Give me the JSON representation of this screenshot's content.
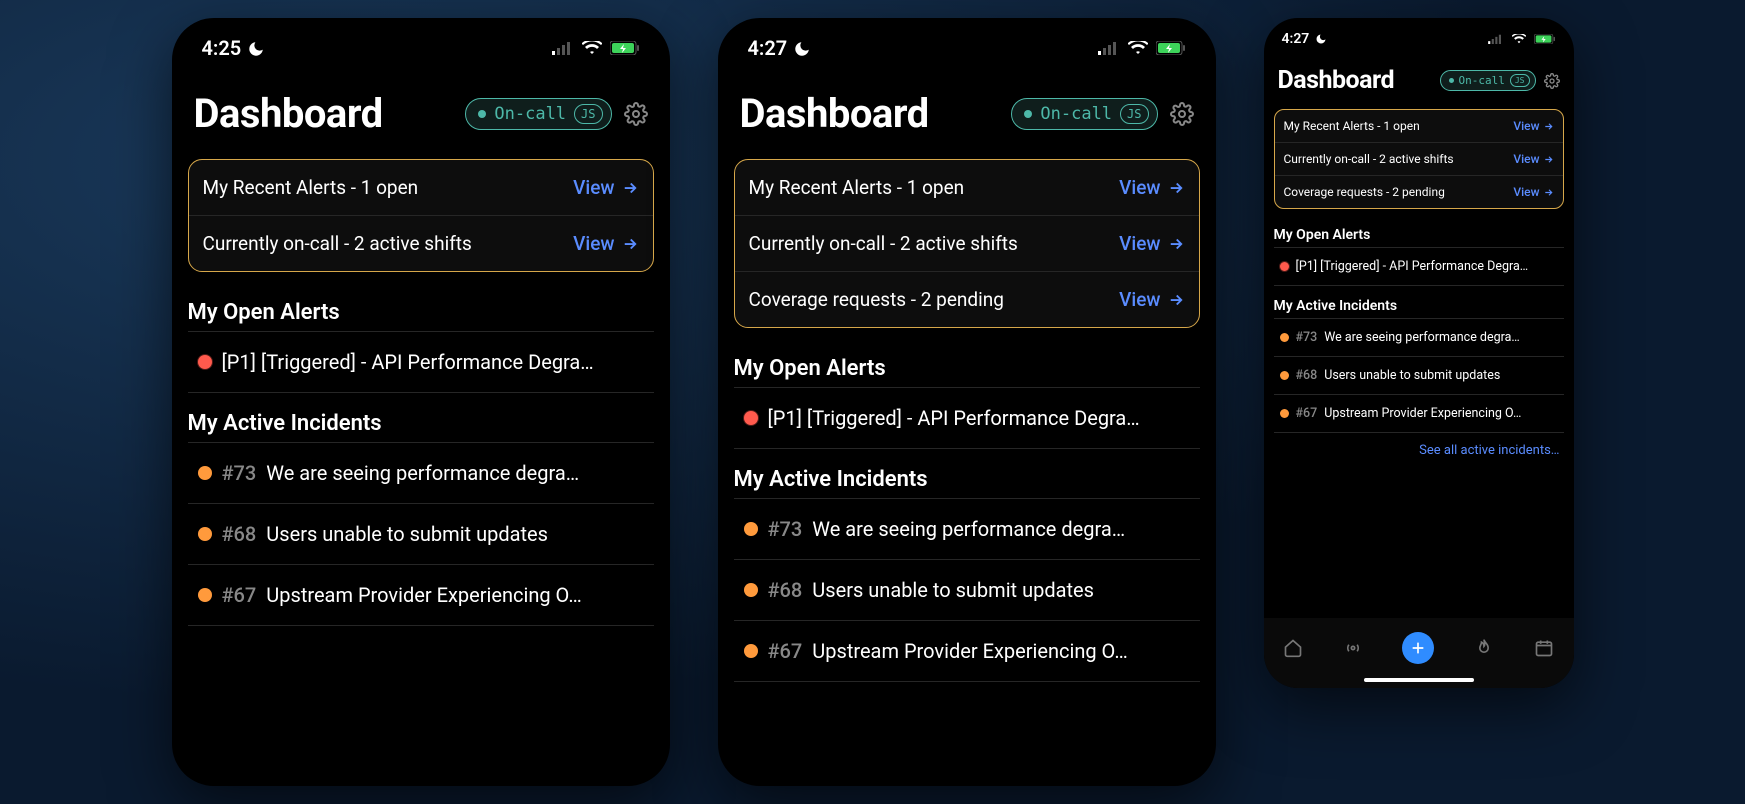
{
  "screens": [
    {
      "time": "4:25",
      "title": "Dashboard",
      "oncall_label": "On-call",
      "avatar": "JS",
      "card_rows": [
        {
          "label": "My Recent Alerts - 1 open",
          "action": "View"
        },
        {
          "label": "Currently on-call - 2 active shifts",
          "action": "View"
        }
      ],
      "alerts_title": "My Open Alerts",
      "alerts": [
        {
          "severity": "red",
          "text": "[P1] [Triggered] - API Performance Degra…"
        }
      ],
      "incidents_title": "My Active Incidents",
      "incidents": [
        {
          "num": "#73",
          "text": "We are seeing performance degra…"
        },
        {
          "num": "#68",
          "text": "Users unable to submit updates"
        },
        {
          "num": "#67",
          "text": "Upstream Provider Experiencing O…"
        }
      ]
    },
    {
      "time": "4:27",
      "title": "Dashboard",
      "oncall_label": "On-call",
      "avatar": "JS",
      "card_rows": [
        {
          "label": "My Recent Alerts - 1 open",
          "action": "View"
        },
        {
          "label": "Currently on-call - 2 active shifts",
          "action": "View"
        },
        {
          "label": "Coverage requests - 2 pending",
          "action": "View"
        }
      ],
      "alerts_title": "My Open Alerts",
      "alerts": [
        {
          "severity": "red",
          "text": "[P1] [Triggered] - API Performance Degra…"
        }
      ],
      "incidents_title": "My Active Incidents",
      "incidents": [
        {
          "num": "#73",
          "text": "We are seeing performance degra…"
        },
        {
          "num": "#68",
          "text": "Users unable to submit updates"
        },
        {
          "num": "#67",
          "text": "Upstream Provider Experiencing O…"
        }
      ]
    },
    {
      "time": "4:27",
      "title": "Dashboard",
      "oncall_label": "On-call",
      "avatar": "JS",
      "card_rows": [
        {
          "label": "My Recent Alerts - 1 open",
          "action": "View"
        },
        {
          "label": "Currently on-call - 2 active shifts",
          "action": "View"
        },
        {
          "label": "Coverage requests - 2 pending",
          "action": "View"
        }
      ],
      "alerts_title": "My Open Alerts",
      "alerts": [
        {
          "severity": "red",
          "text": "[P1] [Triggered] - API Performance Degra…"
        }
      ],
      "incidents_title": "My Active Incidents",
      "incidents": [
        {
          "num": "#73",
          "text": "We are seeing performance degra…"
        },
        {
          "num": "#68",
          "text": "Users unable to submit updates"
        },
        {
          "num": "#67",
          "text": "Upstream Provider Experiencing O…"
        }
      ],
      "see_all": "See all active incidents…"
    }
  ]
}
